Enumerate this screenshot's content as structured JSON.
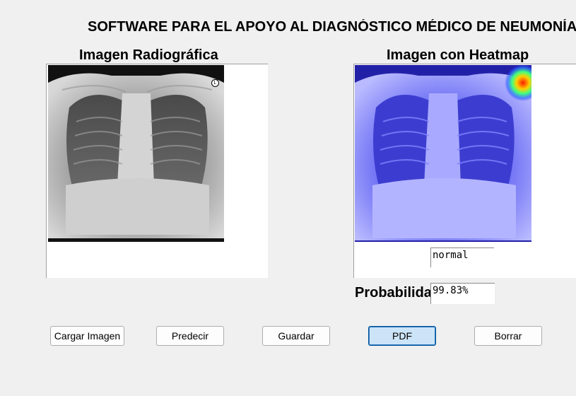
{
  "title": "SOFTWARE PARA EL APOYO AL DIAGNÓSTICO MÉDICO DE NEUMONÍA",
  "left_panel": {
    "title": "Imagen Radiográfica"
  },
  "right_panel": {
    "title": "Imagen con Heatmap"
  },
  "result": {
    "value": "normal"
  },
  "probability": {
    "label": "Probabilidad",
    "value": "99.83%"
  },
  "buttons": {
    "load": "Cargar Imagen",
    "predict": "Predecir",
    "save": "Guardar",
    "pdf": "PDF",
    "clear": "Borrar"
  },
  "colors": {
    "heatmap_tint": "#2a2cff",
    "active_button": "#cce4f7",
    "hotspot": "#ff2000"
  }
}
